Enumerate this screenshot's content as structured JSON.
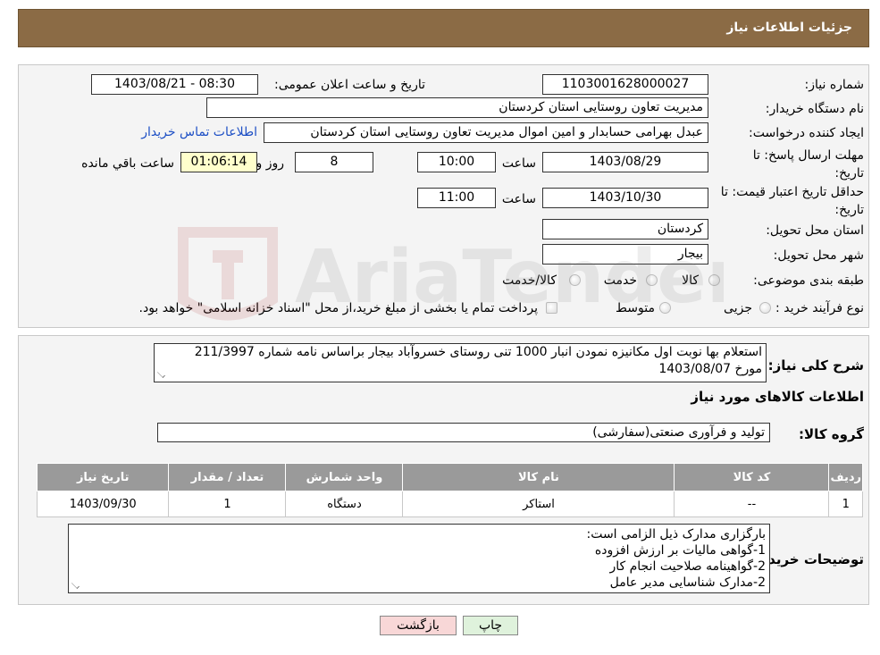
{
  "header": {
    "title": "جزئیات اطلاعات نیاز"
  },
  "form": {
    "need_number_label": "شماره نیاز:",
    "need_number": "1103001628000027",
    "announce_label": "تاریخ و ساعت اعلان عمومی:",
    "announce_value": "1403/08/21 - 08:30",
    "buyer_org_label": "نام دستگاه خریدار:",
    "buyer_org": "مدیریت تعاون روستایی استان کردستان",
    "requester_label": "ایجاد کننده درخواست:",
    "requester": "عبدل بهرامی حسابدار و امین اموال مدیریت تعاون روستایی استان کردستان",
    "contact_link": "اطلاعات تماس خریدار",
    "deadline_label": "مهلت ارسال پاسخ: تا تاریخ:",
    "deadline_date": "1403/08/29",
    "time_label": "ساعت",
    "deadline_time": "10:00",
    "days_value": "8",
    "days_label": "روز و",
    "remaining_time": "01:06:14",
    "remaining_label": "ساعت باقي مانده",
    "validity_label": "حداقل تاریخ اعتبار قیمت: تا تاریخ:",
    "validity_date": "1403/10/30",
    "validity_time": "11:00",
    "province_label": "استان محل تحویل:",
    "province": "کردستان",
    "city_label": "شهر محل تحویل:",
    "city": "بیجار",
    "category_label": "طبقه بندی موضوعی:",
    "category_options": [
      "کالا",
      "خدمت",
      "کالا/خدمت"
    ],
    "purchase_type_label": "نوع فرآیند خرید :",
    "purchase_options": [
      "جزیی",
      "متوسط"
    ],
    "purchase_note": "پرداخت تمام یا بخشی از مبلغ خرید،از محل \"اسناد خزانه اسلامی\" خواهد بود."
  },
  "description": {
    "label": "شرح کلی نیاز:",
    "line1": "استعلام بها نوبت اول مکانیزه نمودن انبار 1000 تنی روستای خسروآباد بیجار براساس نامه شماره 211/3997",
    "line2": "مورخ 1403/08/07"
  },
  "goods": {
    "section_title": "اطلاعات کالاهای مورد نیاز",
    "group_label": "گروه کالا:",
    "group_value": "تولید و فرآوری صنعتی(سفارشی)",
    "columns": [
      "ردیف",
      "کد کالا",
      "نام کالا",
      "واحد شمارش",
      "تعداد / مقدار",
      "تاریخ نیاز"
    ],
    "rows": [
      [
        "1",
        "--",
        "استاکر",
        "دستگاه",
        "1",
        "1403/09/30"
      ]
    ]
  },
  "buyer_notes": {
    "label": "توضیحات خریدار:",
    "lines": [
      "بارگزاری مدارک ذیل الزامی است:",
      "1-گواهی مالیات بر ارزش افزوده",
      "2-گواهینامه صلاحیت انجام کار",
      "2-مدارک شناسایی مدیر عامل"
    ]
  },
  "buttons": {
    "print": "چاپ",
    "back": "بازگشت"
  },
  "watermark": {
    "text": "AriaTender.neT"
  },
  "colors": {
    "header_bg": "#8b6b45",
    "link": "#1d4fc5",
    "table_header": "#9a9a9a",
    "back_button": "#f8d7d7",
    "print_button": "#dff2dc",
    "remaining_bg": "#ffffcc"
  }
}
